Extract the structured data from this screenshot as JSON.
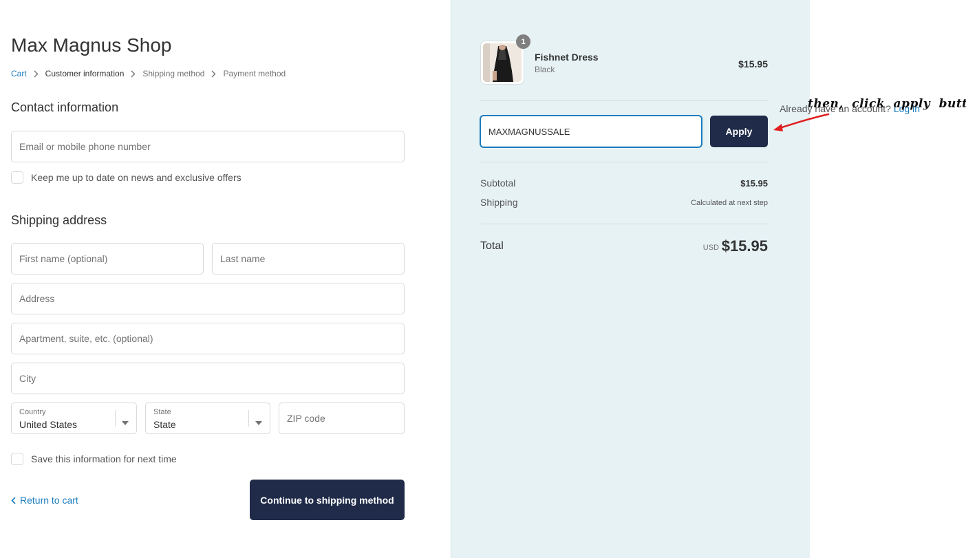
{
  "shop": {
    "title": "Max Magnus Shop"
  },
  "breadcrumb": {
    "items": [
      "Cart",
      "Customer information",
      "Shipping method",
      "Payment method"
    ]
  },
  "contact": {
    "title": "Contact information",
    "account_prompt": "Already have an account?",
    "login_label": "Log in",
    "email_placeholder": "Email or mobile phone number",
    "newsletter_label": "Keep me up to date on news and exclusive offers"
  },
  "shipping": {
    "title": "Shipping address",
    "first_name_placeholder": "First name (optional)",
    "last_name_placeholder": "Last name",
    "address_placeholder": "Address",
    "apartment_placeholder": "Apartment, suite, etc. (optional)",
    "city_placeholder": "City",
    "country_label": "Country",
    "country_value": "United States",
    "state_label": "State",
    "state_value": "State",
    "zip_placeholder": "ZIP code",
    "save_label": "Save this information for next time"
  },
  "footer": {
    "return_label": "Return to cart",
    "continue_label": "Continue to shipping method"
  },
  "order": {
    "product": {
      "name": "Fishnet Dress",
      "variant": "Black",
      "price": "$15.95",
      "quantity": "1"
    },
    "discount": {
      "value": "MAXMAGNUSSALE",
      "apply_label": "Apply"
    },
    "subtotal_label": "Subtotal",
    "subtotal_value": "$15.95",
    "shipping_label": "Shipping",
    "shipping_value": "Calculated at next step",
    "total_label": "Total",
    "total_currency": "USD",
    "total_value": "$15.95"
  },
  "annotation": {
    "text": "then, click apply button",
    "color": "#e02020"
  },
  "colors": {
    "accent": "#197bbd",
    "button": "#1f2b48",
    "sidebar_bg": "#e7f2f5"
  }
}
